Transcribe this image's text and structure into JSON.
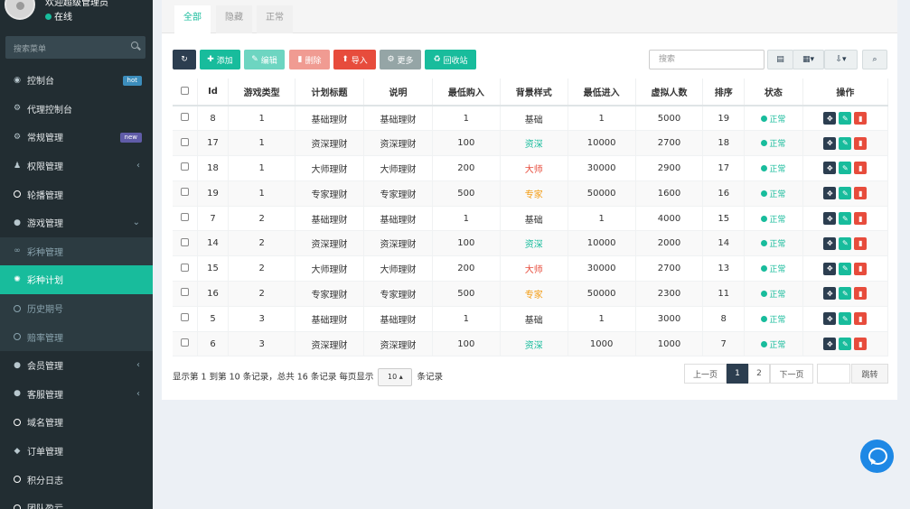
{
  "user": {
    "name": "欢迎超级管理员",
    "status": "在线"
  },
  "sidebar": {
    "search_placeholder": "搜索菜单",
    "items": [
      {
        "label": "控制台",
        "icon": "dashboard-icon",
        "glyph": "◉",
        "badge": "hot"
      },
      {
        "label": "代理控制台",
        "icon": "cog-icon",
        "glyph": "⚙"
      },
      {
        "label": "常规管理",
        "icon": "cogs-icon",
        "glyph": "⚙",
        "badge": "new"
      },
      {
        "label": "权限管理",
        "icon": "group-icon",
        "glyph": "♟",
        "caret": "‹"
      },
      {
        "label": "轮播管理",
        "icon": "circle-icon",
        "glyph": ""
      },
      {
        "label": "游戏管理",
        "icon": "game-icon",
        "glyph": "●",
        "caret": "⌄"
      },
      {
        "label": "彩种管理",
        "icon": "link-icon",
        "glyph": "∞",
        "sub": true
      },
      {
        "label": "彩种计划",
        "icon": "plan-icon",
        "glyph": "✺",
        "sub": true,
        "active": true
      },
      {
        "label": "历史期号",
        "icon": "circle-icon",
        "glyph": "",
        "sub": true
      },
      {
        "label": "赔率管理",
        "icon": "circle-icon",
        "glyph": "",
        "sub": true
      },
      {
        "label": "会员管理",
        "icon": "user-icon",
        "glyph": "●",
        "caret": "‹"
      },
      {
        "label": "客服管理",
        "icon": "comment-icon",
        "glyph": "●",
        "caret": "‹"
      },
      {
        "label": "域名管理",
        "icon": "circle-icon",
        "glyph": ""
      },
      {
        "label": "订单管理",
        "icon": "cube-icon",
        "glyph": "◆"
      },
      {
        "label": "积分日志",
        "icon": "circle-icon",
        "glyph": ""
      },
      {
        "label": "团队盈亏",
        "icon": "circle-icon",
        "glyph": ""
      }
    ]
  },
  "tabs": [
    "全部",
    "隐藏",
    "正常"
  ],
  "toolbar": {
    "refresh_icon": "↻",
    "add": "添加",
    "edit": "编辑",
    "delete": "删除",
    "import": "导入",
    "more": "更多",
    "recycle": "回收站",
    "search_placeholder": "搜索"
  },
  "table": {
    "headers": [
      "Id",
      "游戏类型",
      "计划标题",
      "说明",
      "最低购入",
      "背景样式",
      "最低进入",
      "虚拟人数",
      "排序",
      "状态",
      "操作"
    ],
    "rows": [
      {
        "id": "8",
        "type": "1",
        "title": "基础理财",
        "desc": "基础理财",
        "min_buy": "1",
        "bg": "基础",
        "bg_color": "#333333",
        "min_enter": "1",
        "virtual": "5000",
        "sort": "19",
        "status": "正常"
      },
      {
        "id": "17",
        "type": "1",
        "title": "资深理财",
        "desc": "资深理财",
        "min_buy": "100",
        "bg": "资深",
        "bg_color": "#18bc9c",
        "min_enter": "10000",
        "virtual": "2700",
        "sort": "18",
        "status": "正常"
      },
      {
        "id": "18",
        "type": "1",
        "title": "大师理财",
        "desc": "大师理财",
        "min_buy": "200",
        "bg": "大师",
        "bg_color": "#e74c3c",
        "min_enter": "30000",
        "virtual": "2900",
        "sort": "17",
        "status": "正常"
      },
      {
        "id": "19",
        "type": "1",
        "title": "专家理财",
        "desc": "专家理财",
        "min_buy": "500",
        "bg": "专家",
        "bg_color": "#f39c12",
        "min_enter": "50000",
        "virtual": "1600",
        "sort": "16",
        "status": "正常"
      },
      {
        "id": "7",
        "type": "2",
        "title": "基础理财",
        "desc": "基础理财",
        "min_buy": "1",
        "bg": "基础",
        "bg_color": "#333333",
        "min_enter": "1",
        "virtual": "4000",
        "sort": "15",
        "status": "正常"
      },
      {
        "id": "14",
        "type": "2",
        "title": "资深理财",
        "desc": "资深理财",
        "min_buy": "100",
        "bg": "资深",
        "bg_color": "#18bc9c",
        "min_enter": "10000",
        "virtual": "2000",
        "sort": "14",
        "status": "正常"
      },
      {
        "id": "15",
        "type": "2",
        "title": "大师理财",
        "desc": "大师理财",
        "min_buy": "200",
        "bg": "大师",
        "bg_color": "#e74c3c",
        "min_enter": "30000",
        "virtual": "2700",
        "sort": "13",
        "status": "正常"
      },
      {
        "id": "16",
        "type": "2",
        "title": "专家理财",
        "desc": "专家理财",
        "min_buy": "500",
        "bg": "专家",
        "bg_color": "#f39c12",
        "min_enter": "50000",
        "virtual": "2300",
        "sort": "11",
        "status": "正常"
      },
      {
        "id": "5",
        "type": "3",
        "title": "基础理财",
        "desc": "基础理财",
        "min_buy": "1",
        "bg": "基础",
        "bg_color": "#333333",
        "min_enter": "1",
        "virtual": "3000",
        "sort": "8",
        "status": "正常"
      },
      {
        "id": "6",
        "type": "3",
        "title": "资深理财",
        "desc": "资深理财",
        "min_buy": "100",
        "bg": "资深",
        "bg_color": "#18bc9c",
        "min_enter": "1000",
        "virtual": "1000",
        "sort": "7",
        "status": "正常"
      }
    ]
  },
  "footer": {
    "info_prefix": "显示第 1 到第 10 条记录，总共 16 条记录 每页显示",
    "page_size": "10",
    "info_suffix": "条记录",
    "prev": "上一页",
    "page1": "1",
    "page2": "2",
    "next": "下一页",
    "jump": "跳转"
  }
}
